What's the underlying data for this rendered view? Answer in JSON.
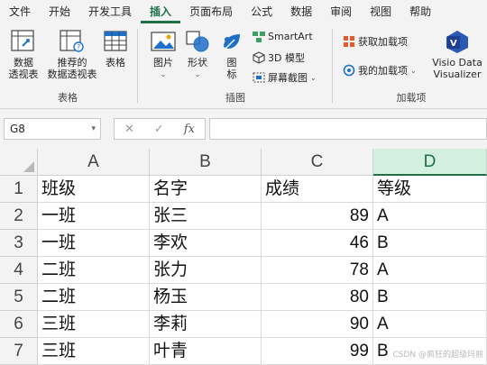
{
  "ribbon": {
    "tabs": [
      "文件",
      "开始",
      "开发工具",
      "插入",
      "页面布局",
      "公式",
      "数据",
      "审阅",
      "视图",
      "帮助"
    ],
    "active_tab": "插入",
    "groups": {
      "tables": {
        "label": "表格",
        "pivot_l1": "数据",
        "pivot_l2": "透视表",
        "rec_l1": "推荐的",
        "rec_l2": "数据透视表",
        "table": "表格"
      },
      "illustrations": {
        "label": "插图",
        "pictures": "图片",
        "shapes": "形状",
        "icons_l1": "图",
        "icons_l2": "标",
        "smartart": "SmartArt",
        "model3d": "3D 模型",
        "screenshot": "屏幕截图"
      },
      "addins": {
        "label": "加载项",
        "get": "获取加载项",
        "my": "我的加载项",
        "visio_l1": "Visio Data",
        "visio_l2": "Visualizer"
      }
    }
  },
  "formula_bar": {
    "name_box": "G8",
    "fx": "fx",
    "value": ""
  },
  "sheet": {
    "columns": [
      "A",
      "B",
      "C",
      "D"
    ],
    "selected_column": "D",
    "rows": [
      {
        "n": "1",
        "a": "班级",
        "b": "名字",
        "c": "成绩",
        "d": "等级"
      },
      {
        "n": "2",
        "a": "一班",
        "b": "张三",
        "c": "89",
        "d": "A"
      },
      {
        "n": "3",
        "a": "一班",
        "b": "李欢",
        "c": "46",
        "d": "B"
      },
      {
        "n": "4",
        "a": "二班",
        "b": "张力",
        "c": "78",
        "d": "A"
      },
      {
        "n": "5",
        "a": "二班",
        "b": "杨玉",
        "c": "80",
        "d": "B"
      },
      {
        "n": "6",
        "a": "三班",
        "b": "李莉",
        "c": "90",
        "d": "A"
      },
      {
        "n": "7",
        "a": "三班",
        "b": "叶青",
        "c": "99",
        "d": "B"
      }
    ]
  },
  "watermark": "CSDN @疯狂的超级玛丽",
  "colors": {
    "accent": "#1e7145",
    "selected_header": "#d3f0e0",
    "ribbon_bg": "#f3f3f3"
  }
}
